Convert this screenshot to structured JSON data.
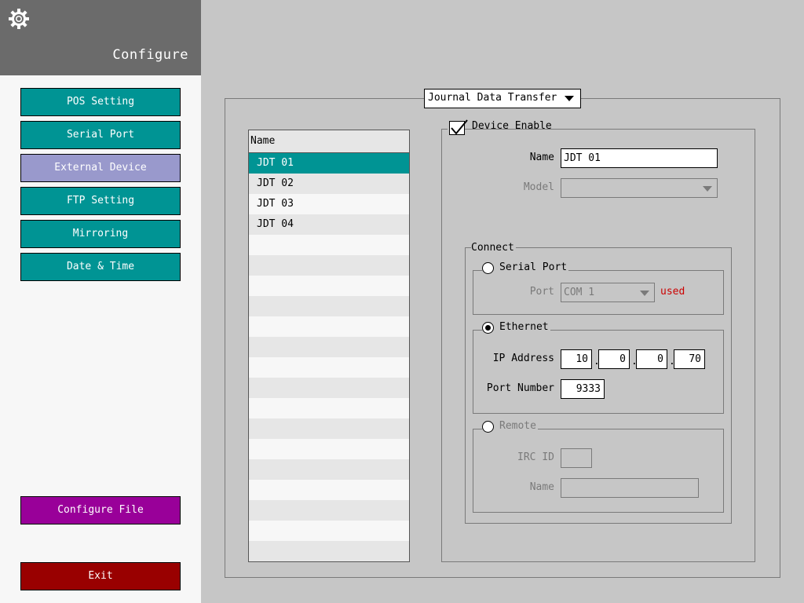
{
  "sidebar": {
    "title": "Configure",
    "items": [
      {
        "label": "POS Setting"
      },
      {
        "label": "Serial Port"
      },
      {
        "label": "External Device"
      },
      {
        "label": "FTP Setting"
      },
      {
        "label": "Mirroring"
      },
      {
        "label": "Date & Time"
      }
    ],
    "configure_file": "Configure File",
    "exit": "Exit"
  },
  "transfer_select": {
    "value": "Journal Data Transfer"
  },
  "list": {
    "header": "Name",
    "items": [
      "JDT 01",
      "JDT 02",
      "JDT 03",
      "JDT 04"
    ]
  },
  "device": {
    "enable_label": "Device Enable",
    "enabled": true,
    "name_label": "Name",
    "name_value": "JDT 01",
    "model_label": "Model",
    "model_value": ""
  },
  "connect": {
    "title": "Connect",
    "serial": {
      "title": "Serial Port",
      "port_label": "Port",
      "port_value": "COM 1",
      "status": "used"
    },
    "ethernet": {
      "title": "Ethernet",
      "ip_label": "IP Address",
      "ip": [
        "10",
        "0",
        "0",
        "70"
      ],
      "port_label": "Port Number",
      "port_value": "9333"
    },
    "remote": {
      "title": "Remote",
      "irc_label": "IRC ID",
      "irc_value": "",
      "name_label": "Name",
      "name_value": ""
    }
  },
  "colors": {
    "teal": "#009494",
    "active": "#9999cc",
    "purple": "#990099",
    "dark_red": "#990000",
    "used_red": "#cc0000"
  }
}
